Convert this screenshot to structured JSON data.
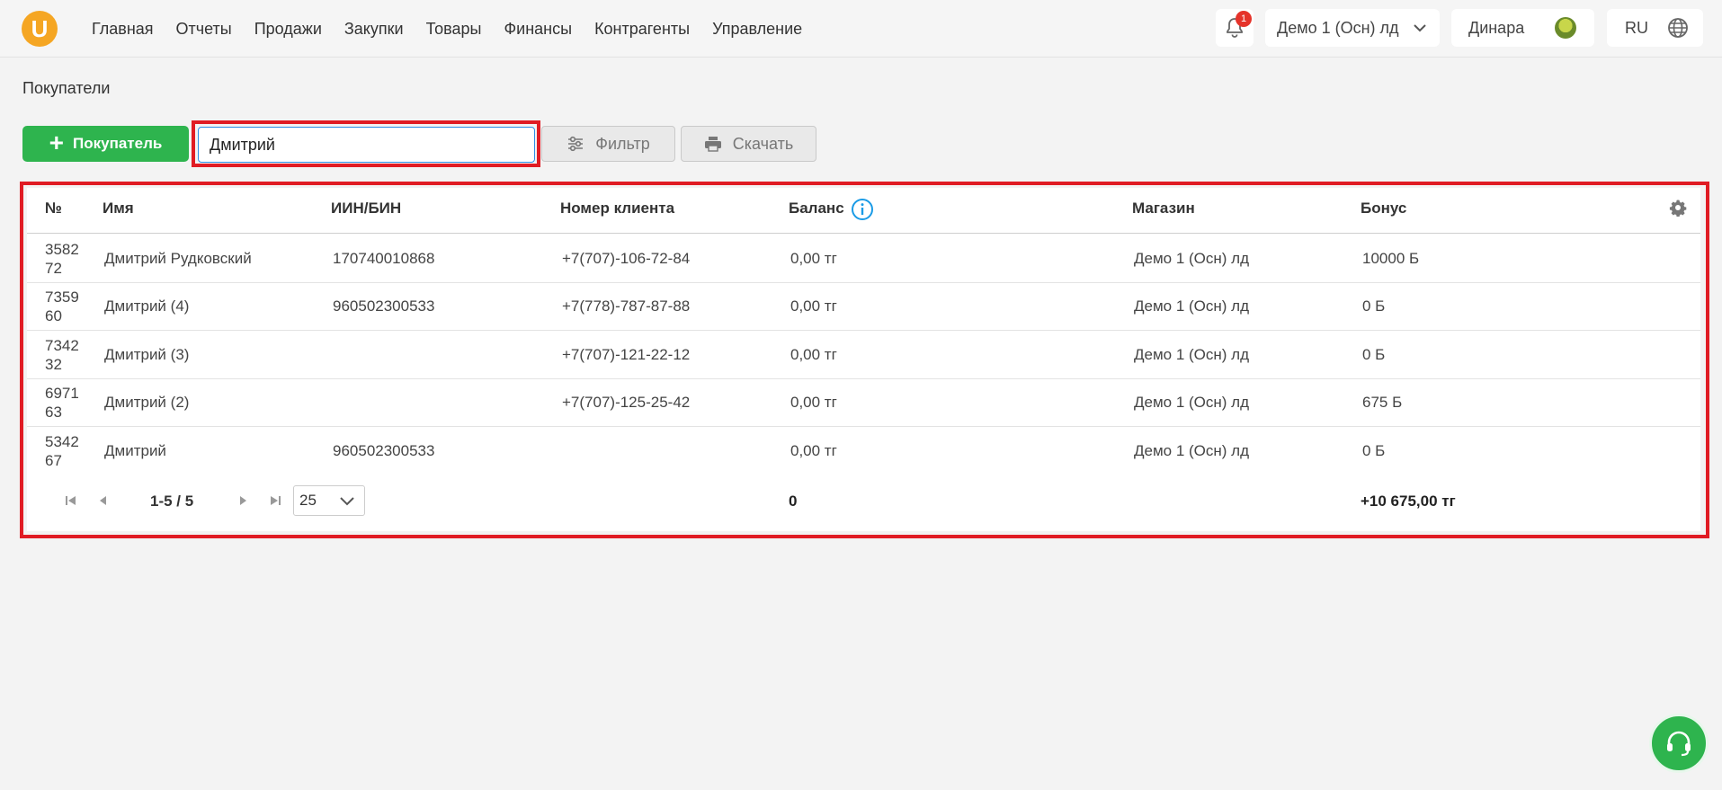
{
  "logo": {
    "letter": "U"
  },
  "nav": {
    "items": [
      "Главная",
      "Отчеты",
      "Продажи",
      "Закупки",
      "Товары",
      "Финансы",
      "Контрагенты",
      "Управление"
    ]
  },
  "header": {
    "notifications_count": "1",
    "store": "Демо 1 (Осн) лд",
    "user": "Динара",
    "lang": "RU"
  },
  "page": {
    "title": "Покупатели"
  },
  "toolbar": {
    "add_label": "Покупатель",
    "search_value": "Дмитрий",
    "filter_label": "Фильтр",
    "download_label": "Скачать"
  },
  "table": {
    "columns": [
      "№",
      "Имя",
      "ИИН/БИН",
      "Номер клиента",
      "Баланс",
      "Магазин",
      "Бонус"
    ],
    "rows": [
      {
        "num": "358272",
        "name": "Дмитрий Рудковский",
        "iin": "170740010868",
        "phone": "+7(707)-106-72-84",
        "balance": "0,00 тг",
        "store": "Демо 1 (Осн) лд",
        "bonus": "10000 Б"
      },
      {
        "num": "735960",
        "name": "Дмитрий (4)",
        "iin": "960502300533",
        "phone": "+7(778)-787-87-88",
        "balance": "0,00 тг",
        "store": "Демо 1 (Осн) лд",
        "bonus": "0 Б"
      },
      {
        "num": "734232",
        "name": "Дмитрий (3)",
        "iin": "",
        "phone": "+7(707)-121-22-12",
        "balance": "0,00 тг",
        "store": "Демо 1 (Осн) лд",
        "bonus": "0 Б"
      },
      {
        "num": "697163",
        "name": "Дмитрий (2)",
        "iin": "",
        "phone": "+7(707)-125-25-42",
        "balance": "0,00 тг",
        "store": "Демо 1 (Осн) лд",
        "bonus": "675 Б"
      },
      {
        "num": "534267",
        "name": "Дмитрий",
        "iin": "960502300533",
        "phone": "",
        "balance": "0,00 тг",
        "store": "Демо 1 (Осн) лд",
        "bonus": "0 Б"
      }
    ],
    "pagination": {
      "range": "1-5 / 5",
      "per_page": "25"
    },
    "totals": {
      "balance": "0",
      "bonus": "+10 675,00 тг"
    }
  },
  "colors": {
    "accent_green": "#2eb44e",
    "highlight_red": "#e01c24",
    "logo_orange": "#f5a623",
    "badge_red": "#e5332a",
    "info_blue": "#1a9be6"
  }
}
